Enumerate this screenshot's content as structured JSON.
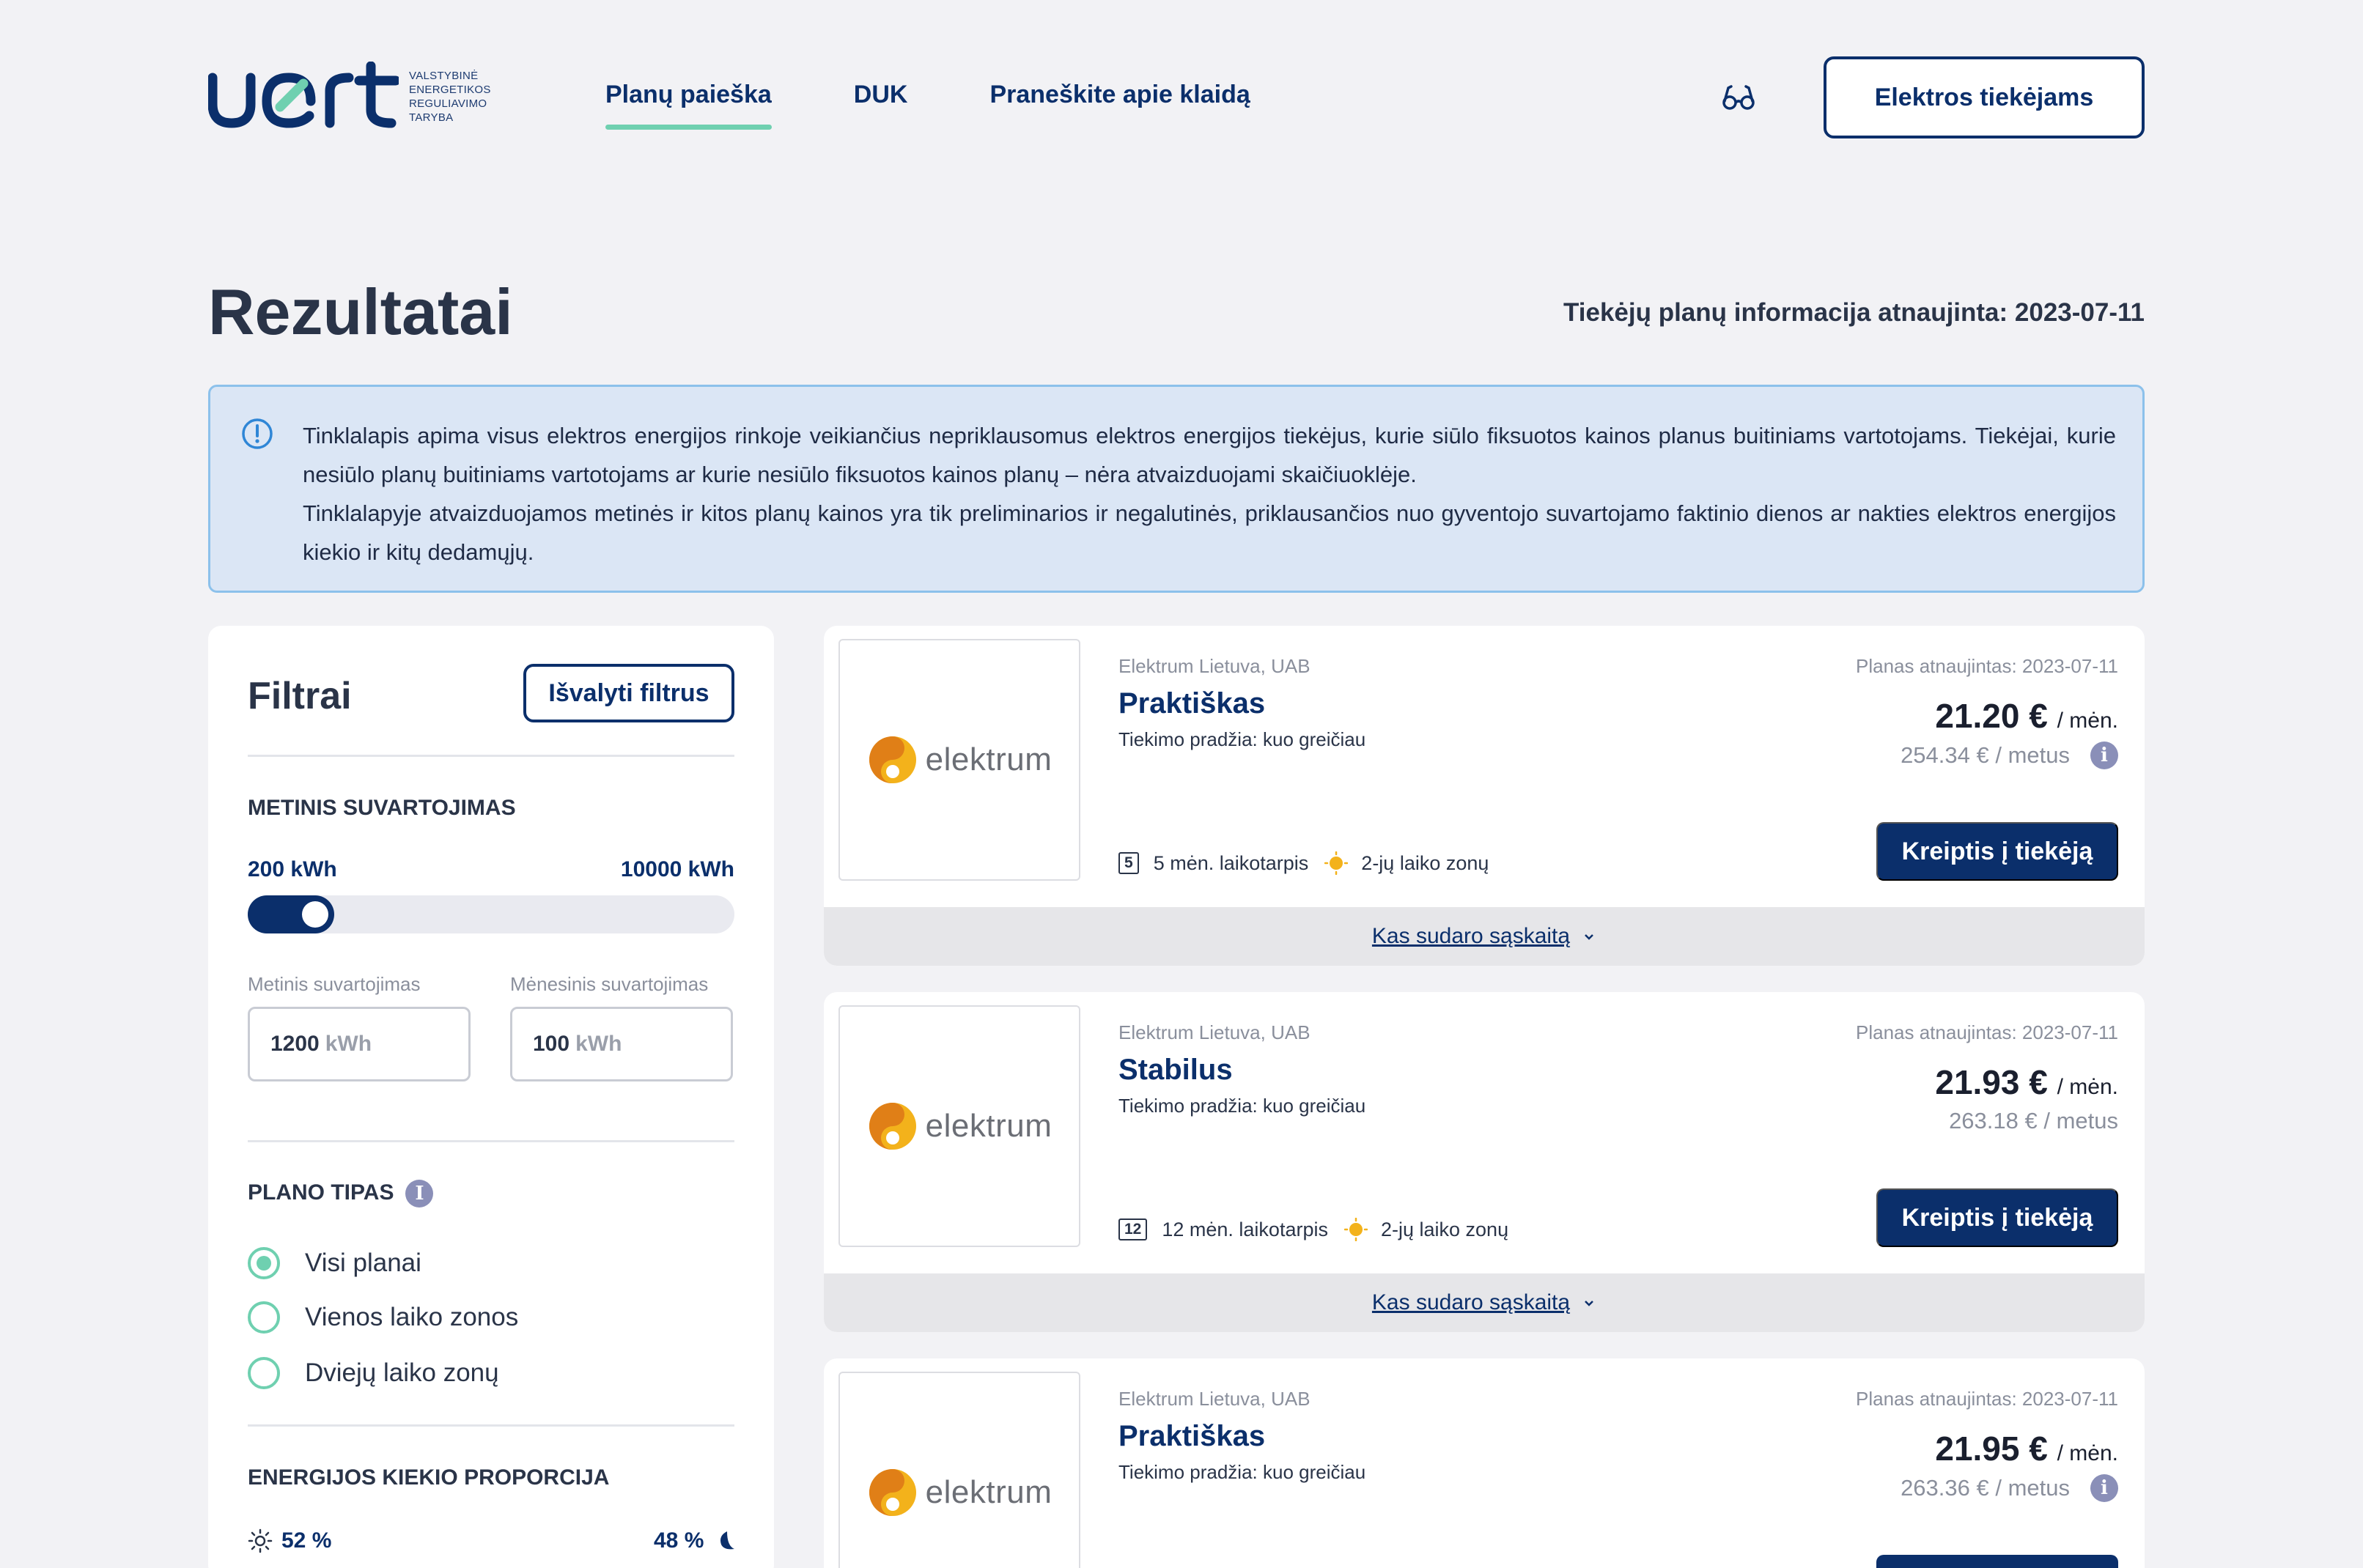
{
  "header": {
    "logo_text": "vert",
    "logo_sub": [
      "Valstybinė",
      "energetikos",
      "reguliavimo",
      "taryba"
    ],
    "nav": [
      {
        "label": "Planų paieška",
        "active": true
      },
      {
        "label": "DUK",
        "active": false
      },
      {
        "label": "Praneškite apie klaidą",
        "active": false
      }
    ],
    "accessibility_icon": "glasses-icon",
    "supplier_button": "Elektros tiekėjams"
  },
  "page": {
    "title": "Rezultatai",
    "updated": "Tiekėjų planų informacija atnaujinta: 2023-07-11",
    "info_p1": "Tinklalapis apima visus elektros energijos rinkoje veikiančius nepriklausomus elektros energijos tiekėjus, kurie siūlo fiksuotos kainos planus buitiniams vartotojams. Tiekėjai, kurie nesiūlo planų buitiniams vartotojams ar kurie nesiūlo fiksuotos kainos planų – nėra atvaizduojami skaičiuoklėje.",
    "info_p2": "Tinklalapyje atvaizduojamos metinės ir kitos planų kainos yra tik preliminarios ir negalutinės, priklausančios nuo gyventojo suvartojamo faktinio dienos ar nakties elektros energijos kiekio ir kitų dedamųjų."
  },
  "filters": {
    "title": "Filtrai",
    "clear_button": "Išvalyti filtrus",
    "annual_label": "Metinis suvartojimas",
    "range_min": "200 kWh",
    "range_max": "10000 kWh",
    "slider_fraction": 0.1,
    "annual_field_label": "Metinis suvartojimas",
    "annual_value": "1200",
    "monthly_field_label": "Mėnesinis suvartojimas",
    "monthly_value": "100",
    "unit": "kWh",
    "plan_type_label": "Plano tipas",
    "plan_types": [
      {
        "label": "Visi planai",
        "checked": true
      },
      {
        "label": "Vienos laiko zonos",
        "checked": false
      },
      {
        "label": "Dviejų laiko zonų",
        "checked": false
      }
    ],
    "energy_label": "Energijos kiekio proporcija",
    "day_percent": "52 %",
    "night_percent": "48 %"
  },
  "plans": [
    {
      "supplier": "Elektrum Lietuva, UAB",
      "name": "Praktiškas",
      "start": "Tiekimo pradžia: kuo greičiau",
      "updated": "Planas atnaujintas: 2023-07-11",
      "price": "21.20 €",
      "price_unit": "/ mėn.",
      "yearly": "254.34 € / metus",
      "period_box": "5",
      "period": "5 mėn. laikotarpis",
      "zones": "2-jų laiko zonų",
      "button": "Kreiptis į tiekėją",
      "footer": "Kas sudaro sąskaitą"
    },
    {
      "supplier": "Elektrum Lietuva, UAB",
      "name": "Stabilus",
      "start": "Tiekimo pradžia: kuo greičiau",
      "updated": "Planas atnaujintas: 2023-07-11",
      "price": "21.93 €",
      "price_unit": "/ mėn.",
      "yearly": "263.18 € / metus",
      "period_box": "12",
      "period": "12 mėn. laikotarpis",
      "zones": "2-jų laiko zonų",
      "button": "Kreiptis į tiekėją",
      "footer": "Kas sudaro sąskaitą"
    },
    {
      "supplier": "Elektrum Lietuva, UAB",
      "name": "Praktiškas",
      "start": "Tiekimo pradžia: kuo greičiau",
      "updated": "Planas atnaujintas: 2023-07-11",
      "price": "21.95 €",
      "price_unit": "/ mėn.",
      "yearly": "263.36 € / metus"
    }
  ],
  "logo_brand": "elektrum",
  "colors": {
    "navy": "#0b2f6b",
    "accent": "#6fd0b0",
    "info_bg": "#dbe6f5",
    "info_border": "#8cc1eb",
    "sun": "#f3b21b"
  }
}
